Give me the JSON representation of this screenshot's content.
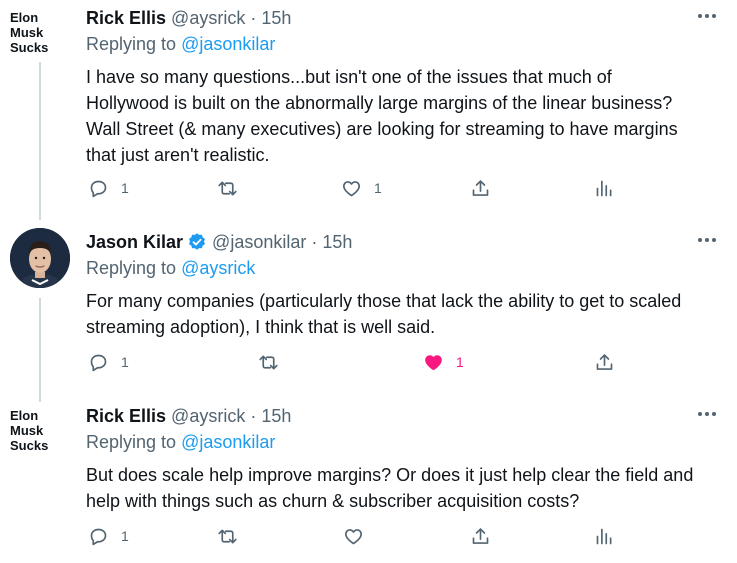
{
  "tweets": [
    {
      "avatar_text": [
        "Elon",
        "Musk",
        "Sucks"
      ],
      "name": "Rick Ellis",
      "handle": "@aysrick",
      "time": "15h",
      "replying_label": "Replying to",
      "replying_mention": "@jasonkilar",
      "lines": [
        "I have so many questions...but isn't one of the issues that much of",
        "Hollywood is built on the abnormally large margins of the linear business?",
        "Wall Street (& many executives) are looking for streaming to have margins",
        "that just aren't realistic."
      ],
      "reply_count": "1",
      "retweet_count": "",
      "like_count": "1",
      "liked": false
    },
    {
      "avatar_text": [],
      "name": "Jason Kilar",
      "verified": true,
      "handle": "@jasonkilar",
      "time": "15h",
      "replying_label": "Replying to",
      "replying_mention": "@aysrick",
      "lines": [
        "For many companies (particularly those that lack the ability to get to scaled",
        "streaming adoption), I think that is well said."
      ],
      "reply_count": "1",
      "retweet_count": "",
      "like_count": "1",
      "liked": true
    },
    {
      "avatar_text": [
        "Elon",
        "Musk",
        "Sucks"
      ],
      "name": "Rick Ellis",
      "handle": "@aysrick",
      "time": "15h",
      "replying_label": "Replying to",
      "replying_mention": "@jasonkilar",
      "lines": [
        "But does scale help improve margins? Or does it just help clear the field and",
        "help with things such as churn & subscriber acquisition costs?"
      ],
      "reply_count": "1",
      "retweet_count": "",
      "like_count": "",
      "liked": false
    }
  ],
  "dot_separator": "·",
  "colors": {
    "accent": "#1d9bf0",
    "like": "#f91880",
    "muted": "#536471",
    "line": "#cfd9de"
  }
}
